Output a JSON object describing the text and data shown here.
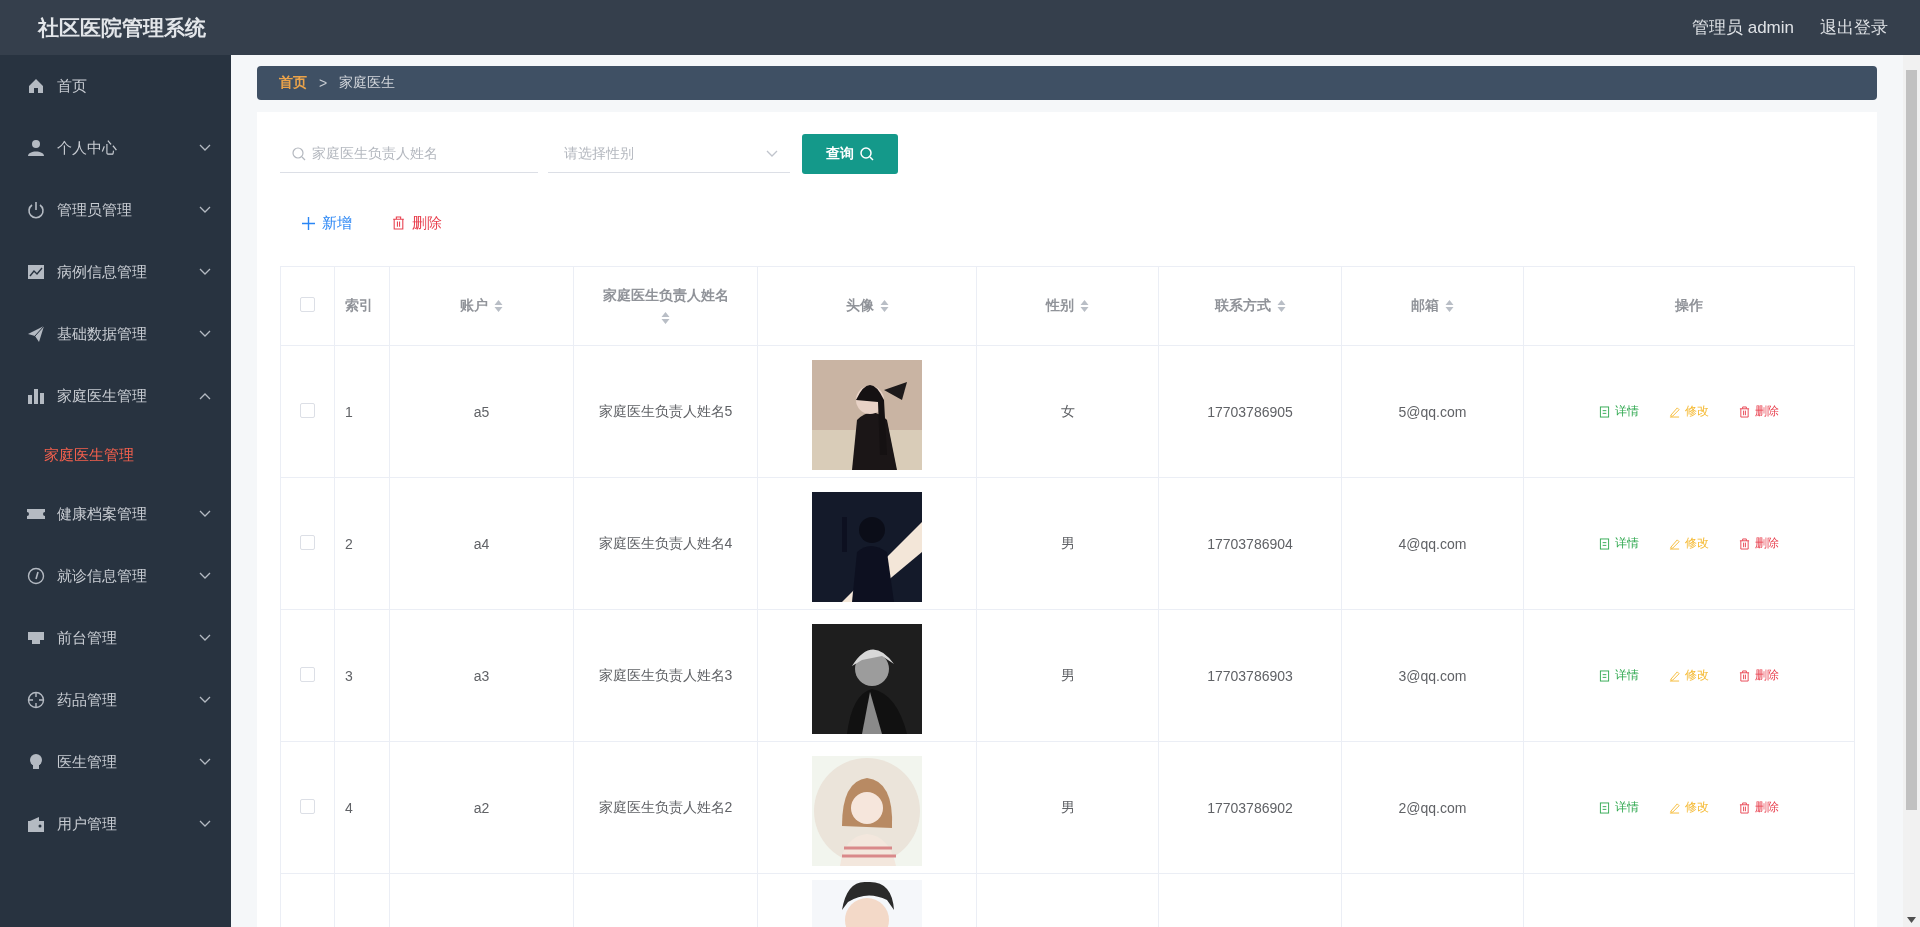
{
  "header": {
    "title": "社区医院管理系统",
    "user": "管理员 admin",
    "logout": "退出登录"
  },
  "sidebar": {
    "items": [
      {
        "label": "首页",
        "kind": "link"
      },
      {
        "label": "个人中心",
        "kind": "submenu",
        "expanded": false
      },
      {
        "label": "管理员管理",
        "kind": "submenu",
        "expanded": false
      },
      {
        "label": "病例信息管理",
        "kind": "submenu",
        "expanded": false
      },
      {
        "label": "基础数据管理",
        "kind": "submenu",
        "expanded": false
      },
      {
        "label": "家庭医生管理",
        "kind": "submenu",
        "expanded": true,
        "children": [
          {
            "label": "家庭医生管理",
            "selected": true
          }
        ]
      },
      {
        "label": "健康档案管理",
        "kind": "submenu",
        "expanded": false
      },
      {
        "label": "就诊信息管理",
        "kind": "submenu",
        "expanded": false
      },
      {
        "label": "前台管理",
        "kind": "submenu",
        "expanded": false
      },
      {
        "label": "药品管理",
        "kind": "submenu",
        "expanded": false
      },
      {
        "label": "医生管理",
        "kind": "submenu",
        "expanded": false
      },
      {
        "label": "用户管理",
        "kind": "submenu",
        "expanded": false
      }
    ]
  },
  "breadcrumb": {
    "items": [
      "首页",
      "家庭医生"
    ],
    "separator": ">"
  },
  "filters": {
    "name_placeholder": "家庭医生负责人姓名",
    "gender_placeholder": "请选择性别",
    "query": "查询"
  },
  "actions": [
    {
      "label": "新增",
      "kind": "add"
    },
    {
      "label": "删除",
      "kind": "delete"
    }
  ],
  "table": {
    "select_all_checked": false,
    "columns": [
      {
        "label": "索引",
        "sortable": false
      },
      {
        "label": "账户",
        "sortable": true
      },
      {
        "label": "家庭医生负责人姓名",
        "sortable": true
      },
      {
        "label": "头像",
        "sortable": true
      },
      {
        "label": "性别",
        "sortable": true
      },
      {
        "label": "联系方式",
        "sortable": true
      },
      {
        "label": "邮箱",
        "sortable": true
      },
      {
        "label": "操作",
        "sortable": false
      }
    ],
    "rows": [
      {
        "checked": false,
        "index": "1",
        "account": "a5",
        "name": "家庭医生负责人姓名5",
        "avatar": {
          "kind": "picture"
        },
        "gender": "女",
        "phone": "17703786905",
        "email": "5@qq.com",
        "ops": [
          {
            "label": "详情",
            "kind": "detail"
          },
          {
            "label": "修改",
            "kind": "edit"
          },
          {
            "label": "删除",
            "kind": "delete"
          }
        ]
      },
      {
        "checked": false,
        "index": "2",
        "account": "a4",
        "name": "家庭医生负责人姓名4",
        "avatar": {
          "kind": "picture"
        },
        "gender": "男",
        "phone": "17703786904",
        "email": "4@qq.com",
        "ops": [
          {
            "label": "详情",
            "kind": "detail"
          },
          {
            "label": "修改",
            "kind": "edit"
          },
          {
            "label": "删除",
            "kind": "delete"
          }
        ]
      },
      {
        "checked": false,
        "index": "3",
        "account": "a3",
        "name": "家庭医生负责人姓名3",
        "avatar": {
          "kind": "picture"
        },
        "gender": "男",
        "phone": "17703786903",
        "email": "3@qq.com",
        "ops": [
          {
            "label": "详情",
            "kind": "detail"
          },
          {
            "label": "修改",
            "kind": "edit"
          },
          {
            "label": "删除",
            "kind": "delete"
          }
        ]
      },
      {
        "checked": false,
        "index": "4",
        "account": "a2",
        "name": "家庭医生负责人姓名2",
        "avatar": {
          "kind": "picture"
        },
        "gender": "男",
        "phone": "17703786902",
        "email": "2@qq.com",
        "ops": [
          {
            "label": "详情",
            "kind": "detail"
          },
          {
            "label": "修改",
            "kind": "edit"
          },
          {
            "label": "删除",
            "kind": "delete"
          }
        ]
      },
      {
        "avatar": {
          "kind": "picture"
        }
      }
    ]
  }
}
